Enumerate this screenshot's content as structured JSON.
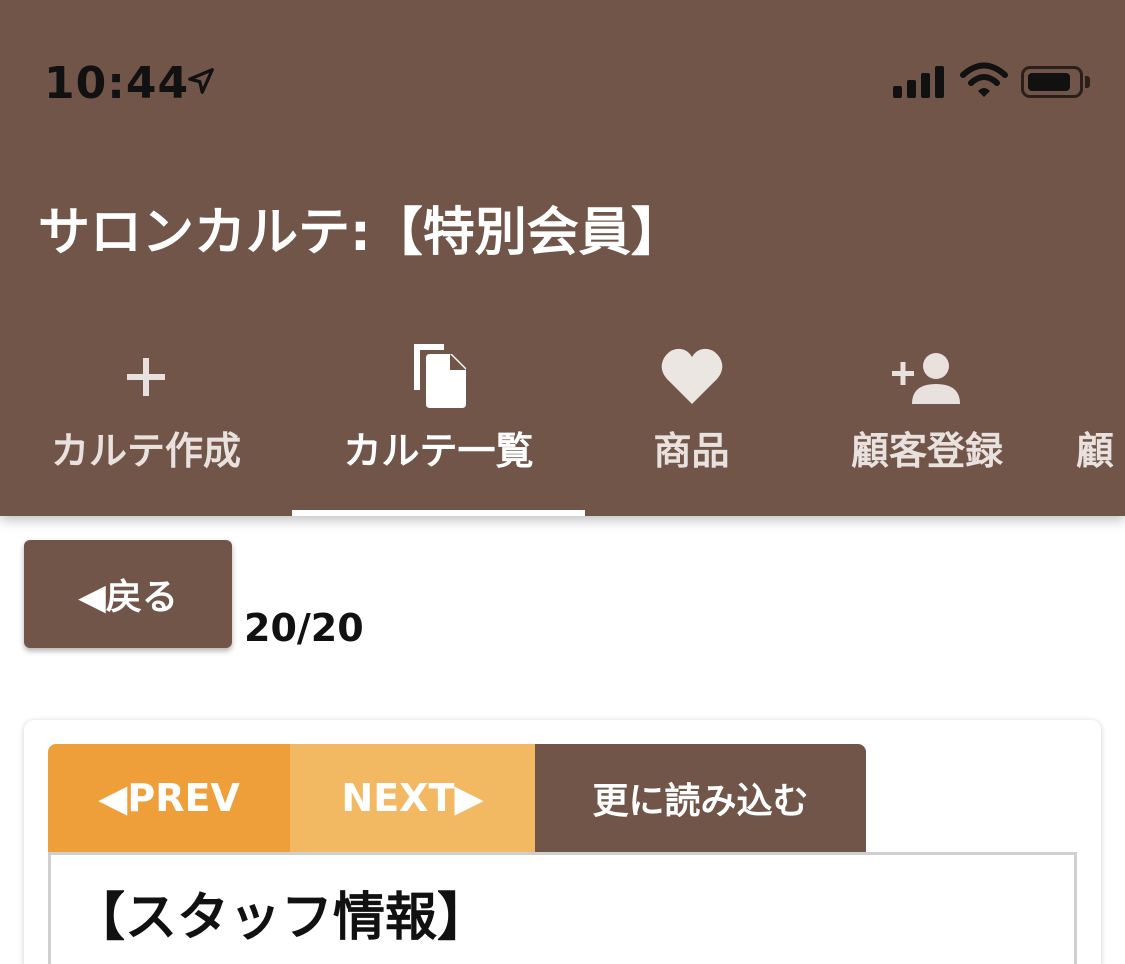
{
  "status_bar": {
    "time": "10:44",
    "icons": [
      "location-arrow-icon",
      "cellular-signal-icon",
      "wifi-icon",
      "battery-icon"
    ]
  },
  "app": {
    "title": "サロンカルテ:【特別会員】"
  },
  "tabs": [
    {
      "label": "カルテ作成",
      "icon": "plus-icon"
    },
    {
      "label": "カルテ一覧",
      "icon": "documents-icon",
      "active": true
    },
    {
      "label": "商品",
      "icon": "heart-icon"
    },
    {
      "label": "顧客登録",
      "icon": "add-person-icon"
    },
    {
      "label": "顧"
    }
  ],
  "nav": {
    "back_label": "◀戻る",
    "counter": "20/20"
  },
  "card": {
    "prev_label": "◀PREV",
    "next_label": "NEXT▶",
    "more_label": "更に読み込む",
    "section_heading": "【スタッフ情報】"
  },
  "colors": {
    "primary": "#725549",
    "prev": "#ef9f39",
    "next": "#f2b962"
  }
}
